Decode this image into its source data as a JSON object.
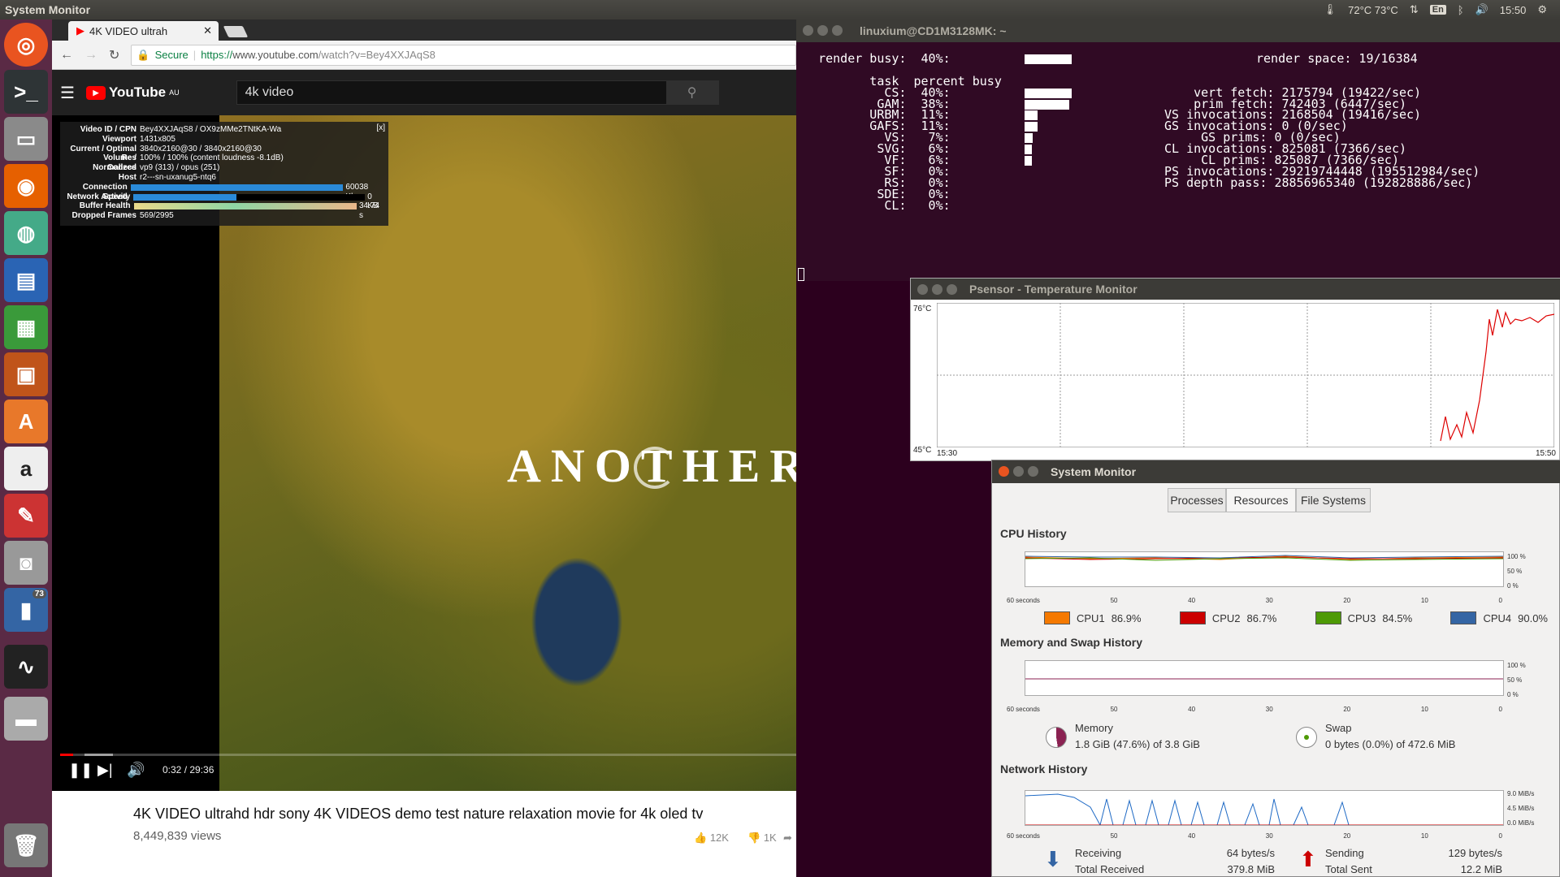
{
  "topbar": {
    "app_title": "System Monitor",
    "temps": "72°C 73°C",
    "kbd": "En",
    "clock": "15:50"
  },
  "launcher": {
    "badge": "73"
  },
  "browser": {
    "tab_title": "4K VIDEO ultrah",
    "secure": "Secure",
    "url_scheme": "https://",
    "url_host": "www.youtube.com",
    "url_path": "/watch?v=Bey4XXJAqS8",
    "yt_logo": "YouTube",
    "yt_region": "AU",
    "search_value": "4k video"
  },
  "stats": {
    "rows": [
      {
        "k": "Video ID / CPN",
        "v": "Bey4XXJAqS8 / OX9zMMe2TNtKA-Wa"
      },
      {
        "k": "Viewport",
        "v": "1431x805"
      },
      {
        "k": "Current / Optimal Res",
        "v": "3840x2160@30 / 3840x2160@30"
      },
      {
        "k": "Volume / Normalized",
        "v": "100% / 100% (content loudness -8.1dB)"
      },
      {
        "k": "Codecs",
        "v": "vp9 (313) / opus (251)"
      },
      {
        "k": "Host",
        "v": "r2---sn-uxanug5-ntq6"
      }
    ],
    "bars": [
      {
        "k": "Connection Speed",
        "v": "60038 Kbps"
      },
      {
        "k": "Network Activity",
        "v": "0 KB"
      },
      {
        "k": "Buffer Health",
        "v": "34.74 s"
      }
    ],
    "dropped_label": "Dropped Frames",
    "dropped": "569/2995",
    "close": "[x]"
  },
  "video": {
    "overlay_title": "ANOTHER W",
    "time": "0:32 / 29:36",
    "progress_fraction": 0.018,
    "title": "4K VIDEO ultrahd hdr sony 4K VIDEOS demo test nature relaxation movie for 4k oled tv",
    "views": "8,449,839 views",
    "likes": "12K",
    "dislikes": "1K"
  },
  "terminal": {
    "title": "linuxium@CD1M3128MK: ~",
    "lines_left": [
      "   render busy:  40%:",
      "",
      "          task  percent busy",
      "            CS:  40%:",
      "           GAM:  38%:",
      "          URBM:  11%:",
      "          GAFS:  11%:",
      "            VS:   7%:",
      "           SVG:   6%:",
      "            VF:   6%:",
      "            SF:   0%:",
      "            RS:   0%:",
      "           SDE:   0%:",
      "            CL:   0%:"
    ],
    "busy_pct": [
      40,
      0,
      0,
      40,
      38,
      11,
      11,
      7,
      6,
      6,
      0,
      0,
      0,
      0
    ],
    "lines_right": [
      "render space: 19/16384",
      "",
      "",
      "    vert fetch: 2175794 (19422/sec)",
      "    prim fetch: 742403 (6447/sec)",
      "VS invocations: 2168504 (19416/sec)",
      "GS invocations: 0 (0/sec)",
      "     GS prims: 0 (0/sec)",
      "CL invocations: 825081 (7366/sec)",
      "     CL prims: 825087 (7366/sec)",
      "PS invocations: 29219744448 (195512984/sec)",
      "PS depth pass: 28856965340 (192828886/sec)"
    ]
  },
  "psensor": {
    "title": "Psensor - Temperature Monitor",
    "ymax": "76°C",
    "ymin": "45°C",
    "tstart": "15:30",
    "tend": "15:50"
  },
  "sysmon": {
    "title": "System Monitor",
    "tabs": [
      "Processes",
      "Resources",
      "File Systems"
    ],
    "cpu_head": "CPU History",
    "mem_head": "Memory and Swap History",
    "net_head": "Network History",
    "x_ticks": [
      "60 seconds",
      "50",
      "40",
      "30",
      "20",
      "10",
      "0"
    ],
    "pct_ticks": [
      "100 %",
      "50 %",
      "0 %"
    ],
    "net_ticks": [
      "9.0 MiB/s",
      "4.5 MiB/s",
      "0.0 MiB/s"
    ],
    "cpus": [
      {
        "name": "CPU1",
        "val": "86.9%",
        "color": "#f57900"
      },
      {
        "name": "CPU2",
        "val": "86.7%",
        "color": "#cc0000"
      },
      {
        "name": "CPU3",
        "val": "84.5%",
        "color": "#4e9a06"
      },
      {
        "name": "CPU4",
        "val": "90.0%",
        "color": "#3465a4"
      }
    ],
    "memory_label": "Memory",
    "memory_val": "1.8 GiB (47.6%) of 3.8 GiB",
    "swap_label": "Swap",
    "swap_val": "0 bytes (0.0%) of 472.6 MiB",
    "recv_label": "Receiving",
    "recv_val": "64 bytes/s",
    "recv_total_label": "Total Received",
    "recv_total": "379.8 MiB",
    "send_label": "Sending",
    "send_val": "129 bytes/s",
    "send_total_label": "Total Sent",
    "send_total": "12.2 MiB"
  }
}
